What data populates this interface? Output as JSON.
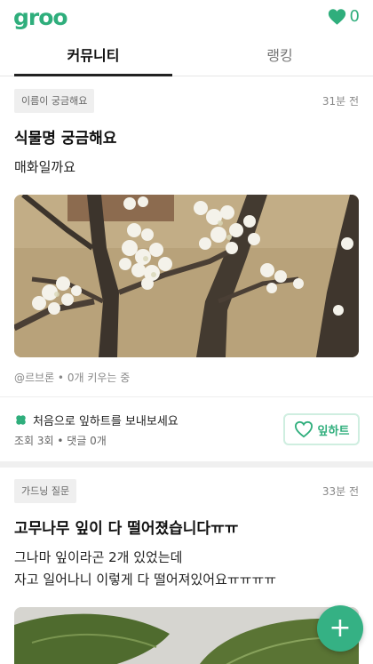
{
  "app": {
    "logo": "groo"
  },
  "header": {
    "likes_count": "0"
  },
  "tabs": [
    {
      "label": "커뮤니티"
    },
    {
      "label": "랭킹"
    }
  ],
  "posts": [
    {
      "tag": "이름이 궁금해요",
      "time": "31분 전",
      "title": "식물명 궁금해요",
      "body": "매화일까요",
      "author_line": "@르브론 • 0개 키우는 중",
      "prompt": "처음으로 잎하트를 보내보세요",
      "stats": "조회 3회 • 댓글 0개",
      "leaf_button": "잎하트"
    },
    {
      "tag": "가드닝 질문",
      "time": "33분 전",
      "title": "고무나무 잎이 다 떨어졌습니다ㅠㅠ",
      "body_lines": [
        "그나마 잎이라곤 2개 있었는데",
        "자고 일어나니 이렇게 다 떨어져있어요ㅠㅠㅠㅠ"
      ]
    }
  ],
  "fab": {
    "label": "+"
  },
  "colors": {
    "accent": "#2fae7c"
  }
}
